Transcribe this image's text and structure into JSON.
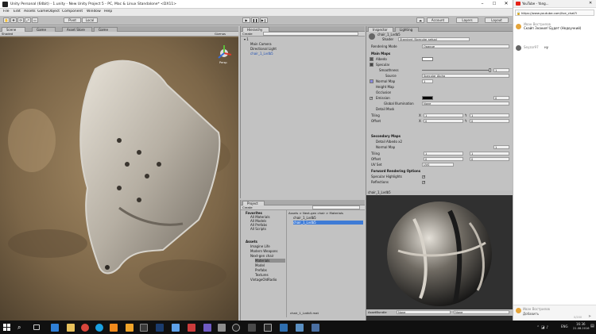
{
  "unity": {
    "title": "Unity Personal (64bit) - 1.unity - New Unity Project 5 - PC, Mac & Linux Standalone* <DX11>",
    "menu": [
      "File",
      "Edit",
      "Assets",
      "GameObject",
      "Component",
      "Window",
      "Help"
    ],
    "toolbar": {
      "pivot": "Pivot",
      "local": "Local",
      "account": "Account",
      "layers": "Layers",
      "layout": "Layout"
    },
    "scene": {
      "tabs": [
        "Scene",
        "Game",
        "Asset Store",
        "Game"
      ],
      "shaded": "Shaded",
      "gizmos": "Gizmos",
      "persp": "Persp"
    },
    "hierarchy": {
      "tab": "Hierarchy",
      "create": "Create",
      "scene_name": "1",
      "items": [
        "Main Camera",
        "Directional Light",
        "chair_1_Lvdb5"
      ]
    },
    "project": {
      "tab": "Project",
      "create": "Create",
      "favorites_label": "Favorites",
      "favorites": [
        "All Materials",
        "All Models",
        "All Prefabs",
        "All Scripts"
      ],
      "assets_label": "Assets",
      "tree": [
        "Imagine Life",
        "Modern Weapons",
        "Next-gen chair",
        "Materials",
        "Model",
        "Prefabs",
        "Textures",
        "VintageOldRadio"
      ],
      "breadcrumb": "Assets > Next-gen chair > Materials",
      "files": [
        "chair_1_Lvdb5",
        "chair_1_Lvdb5"
      ],
      "footer_file": "chair_1_Lvdb5.mat"
    },
    "inspector": {
      "tabs": [
        "Inspector",
        "Lighting"
      ],
      "material_name": "chair_1_Lvdb5",
      "shader_label": "Shader",
      "shader_value": "Standard (Specular setup)",
      "rendering_mode_label": "Rendering Mode",
      "rendering_mode_value": "Opaque",
      "main_maps": "Main Maps",
      "albedo": "Albedo",
      "specular": "Specular",
      "smoothness": "Smoothness",
      "smoothness_value": "1",
      "source": "Source",
      "source_value": "Specular Alpha",
      "normal_map": "Normal Map",
      "normal_value": "1",
      "height_map": "Height Map",
      "occlusion": "Occlusion",
      "emission": "Emission",
      "emission_value": "0",
      "global_illum": "Global Illumination",
      "global_illum_value": "None",
      "detail_mask": "Detail Mask",
      "tiling": "Tiling",
      "offset": "Offset",
      "x": "X",
      "y": "Y",
      "tiling_x": "1",
      "tiling_y": "1",
      "offset_x": "0",
      "offset_y": "0",
      "secondary_maps": "Secondary Maps",
      "detail_albedo": "Detail Albedo x2",
      "sec_normal_map": "Normal Map",
      "sec_normal_value": "1",
      "sec_tiling_x": "1",
      "sec_tiling_y": "1",
      "sec_offset_x": "0",
      "sec_offset_y": "0",
      "uv_set": "UV Set",
      "uv_set_value": "UV0",
      "forward_options": "Forward Rendering Options",
      "specular_highlights": "Specular Highlights",
      "reflections": "Reflections",
      "preview_title": "chair_1_Lvdb5",
      "asset_bundle": "AssetBundle",
      "bundle_none": "None",
      "bundle_none2": "None"
    }
  },
  "chrome": {
    "tab_title": "YouTube - Yang...",
    "url": "https://www.youtube.com/live_chat?i",
    "chat": [
      {
        "name": "Иван Вострилов",
        "text": "Скайп Знания! Будет (Недоучкий)"
      },
      {
        "name": "Seyzor97",
        "text": "ну"
      }
    ],
    "input_name": "Иван Вострилов",
    "input_placeholder": "Добавить",
    "counter": "0/200"
  },
  "taskbar": {
    "lang": "ENG",
    "time": "16:36",
    "date": "21.08.2016"
  },
  "colors": {
    "accent": "#3e7bd6",
    "sand": "#8c7555",
    "leather": "#c8c3bc"
  }
}
